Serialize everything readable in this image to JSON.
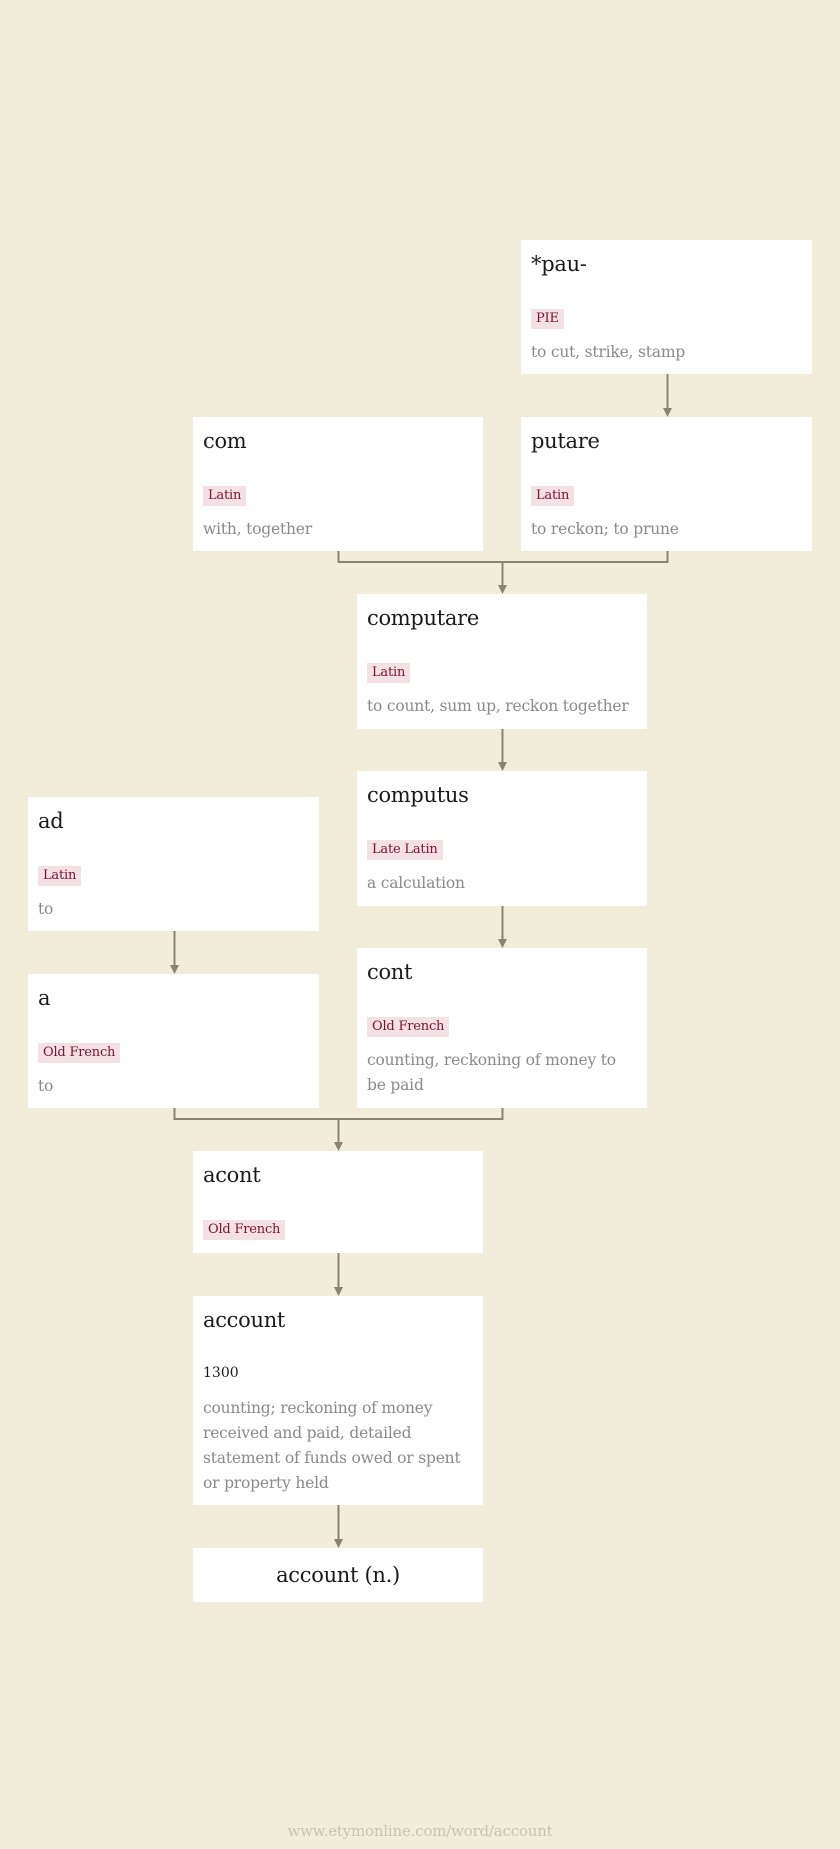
{
  "nodes": {
    "pau": {
      "word": "*pau-",
      "language": "PIE",
      "gloss": "to cut, strike, stamp"
    },
    "com": {
      "word": "com",
      "language": "Latin",
      "gloss": "with, together"
    },
    "putare": {
      "word": "putare",
      "language": "Latin",
      "gloss": "to reckon; to prune"
    },
    "computare": {
      "word": "computare",
      "language": "Latin",
      "gloss": "to count, sum up, reckon together"
    },
    "computus": {
      "word": "computus",
      "language": "Late Latin",
      "gloss": "a calculation"
    },
    "ad": {
      "word": "ad",
      "language": "Latin",
      "gloss": "to"
    },
    "a": {
      "word": "a",
      "language": "Old French",
      "gloss": "to"
    },
    "cont": {
      "word": "cont",
      "language": "Old French",
      "gloss": "counting, reckoning of money to be paid"
    },
    "acont": {
      "word": "acont",
      "language": "Old French"
    },
    "account": {
      "word": "account",
      "year": "1300",
      "gloss": "counting; reckoning of money received and paid, detailed statement of funds owed or spent or property held"
    },
    "final": {
      "word": "account (n.)"
    }
  },
  "edges": [
    {
      "from": [
        "pau"
      ],
      "to": "putare"
    },
    {
      "from": [
        "com",
        "putare"
      ],
      "to": "computare"
    },
    {
      "from": [
        "computare"
      ],
      "to": "computus"
    },
    {
      "from": [
        "computus"
      ],
      "to": "cont"
    },
    {
      "from": [
        "ad"
      ],
      "to": "a"
    },
    {
      "from": [
        "a",
        "cont"
      ],
      "to": "acont"
    },
    {
      "from": [
        "acont"
      ],
      "to": "account"
    },
    {
      "from": [
        "account"
      ],
      "to": "final"
    }
  ],
  "colors": {
    "background": "#f2ecdb",
    "connector": "#8a8370",
    "tag_bg": "#f3e1e5",
    "tag_text": "#7b1232",
    "gloss": "#8a8a8a"
  },
  "footer": {
    "url_text": "www.etymonline.com/word/account"
  }
}
